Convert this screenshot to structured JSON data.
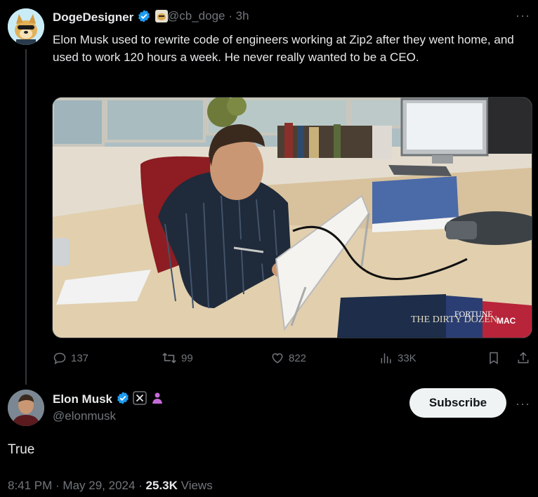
{
  "tweet": {
    "author_name": "DogeDesigner",
    "handle": "@cb_doge",
    "time": "3h",
    "text": "Elon Musk used to rewrite code of engineers working at Zip2 after they went home, and used to work 120 hours a week. He never really wanted to be a CEO.",
    "photo_book_titles": [
      "THE DIRTY DOZEN",
      "FORTUNE",
      "MAC"
    ],
    "stats": {
      "replies": "137",
      "reposts": "99",
      "likes": "822",
      "views": "33K"
    }
  },
  "reply": {
    "author_name": "Elon Musk",
    "handle": "@elonmusk",
    "subscribe_label": "Subscribe",
    "text": "True",
    "timestamp": "8:41 PM · May 29, 2024 · ",
    "views_count": "25.3K",
    "views_label": "Views"
  },
  "colors": {
    "verified_blue": "#1d9bf0",
    "affiliate_purple": "#c46bd8",
    "muted": "#71767b",
    "text": "#e7e9ea"
  },
  "icons": [
    "verified-badge-icon",
    "doge-affiliate-icon",
    "more-icon",
    "reply-icon",
    "repost-icon",
    "like-icon",
    "views-icon",
    "bookmark-icon",
    "share-icon",
    "x-logo-icon",
    "person-badge-icon"
  ]
}
